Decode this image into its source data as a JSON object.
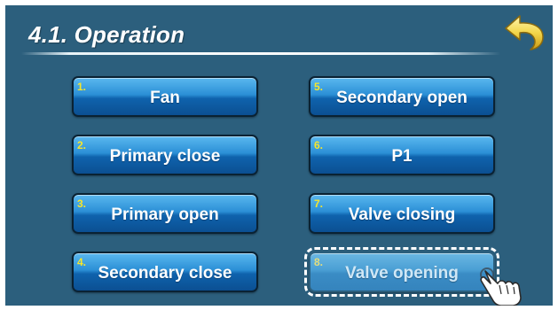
{
  "header": {
    "title": "4.1. Operation"
  },
  "back_button": {
    "icon": "back-arrow-icon",
    "color": "#f3d64a"
  },
  "buttons": [
    {
      "num": "1.",
      "label": "Fan"
    },
    {
      "num": "2.",
      "label": "Primary close"
    },
    {
      "num": "3.",
      "label": "Primary open"
    },
    {
      "num": "4.",
      "label": "Secondary close"
    },
    {
      "num": "5.",
      "label": "Secondary open"
    },
    {
      "num": "6.",
      "label": "P1"
    },
    {
      "num": "7.",
      "label": "Valve closing"
    },
    {
      "num": "8.",
      "label": "Valve opening",
      "selected": true
    }
  ],
  "colors": {
    "background": "#2c5f7d",
    "button": "#1e7ac4",
    "number": "#f7e62a",
    "title": "#ffffff"
  },
  "pointer": {
    "icon": "hand-pointer-icon"
  }
}
